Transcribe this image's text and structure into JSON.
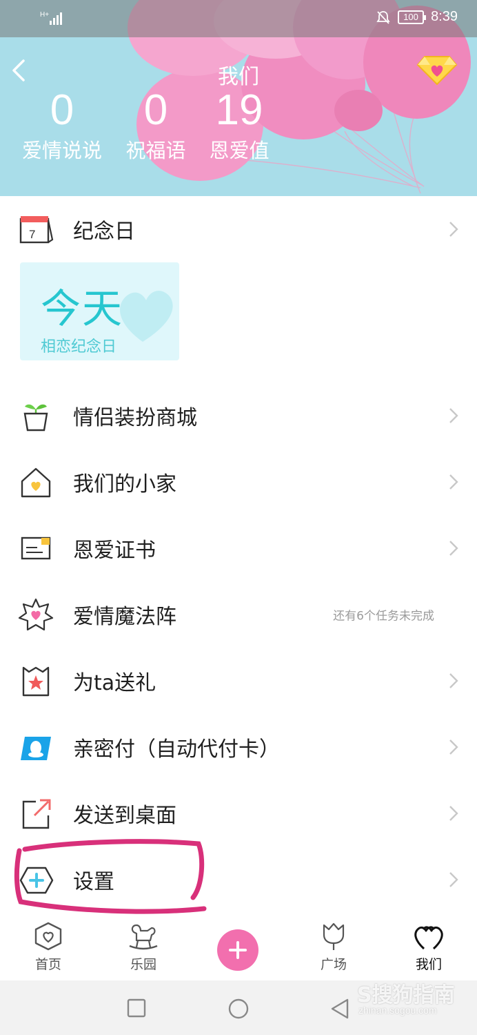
{
  "status_bar": {
    "network": "H+",
    "battery": "100",
    "time": "8:39"
  },
  "header": {
    "title": "我们",
    "stats": [
      {
        "value": "0",
        "label": "爱情说说"
      },
      {
        "value": "0",
        "label": "祝福语"
      },
      {
        "value": "19",
        "label": "恩爱值"
      }
    ]
  },
  "anniversary": {
    "title": "纪念日",
    "calendar_day": "7",
    "card_big": "今天",
    "card_small": "相恋纪念日"
  },
  "menu": [
    {
      "label": "情侣装扮商城",
      "hint": ""
    },
    {
      "label": "我们的小家",
      "hint": ""
    },
    {
      "label": "恩爱证书",
      "hint": ""
    },
    {
      "label": "爱情魔法阵",
      "hint": "还有6个任务未完成"
    },
    {
      "label": "为ta送礼",
      "hint": ""
    },
    {
      "label": "亲密付（自动代付卡）",
      "hint": ""
    },
    {
      "label": "发送到桌面",
      "hint": ""
    },
    {
      "label": "设置",
      "hint": ""
    }
  ],
  "tabs": [
    {
      "label": "首页"
    },
    {
      "label": "乐园"
    },
    {
      "label": "广场"
    },
    {
      "label": "我们"
    }
  ],
  "watermark": {
    "main": "S搜狗指南",
    "sub": "zhinan.sogou.com"
  },
  "colors": {
    "accent_pink": "#f26fae",
    "teal": "#26c6cf",
    "header_bg": "#a9dde9",
    "annotation": "#d8307a"
  }
}
